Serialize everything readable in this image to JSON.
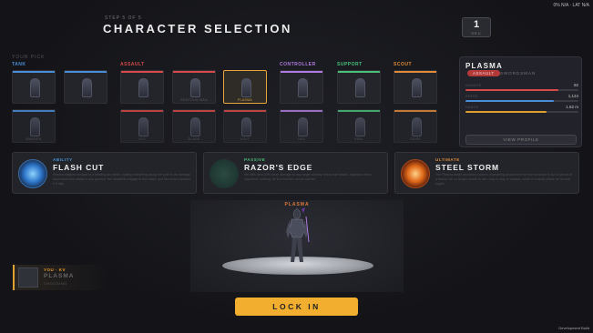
{
  "network": {
    "text": "0% N/A  ·  LAT N/A"
  },
  "header": {
    "step": "STEP 5 OF 5",
    "title": "CHARACTER SELECTION",
    "timer_value": "1",
    "timer_label": "SEC"
  },
  "picks_label": "YOUR PICK",
  "categories": [
    {
      "label": "TANK",
      "color": "#4a8ed8"
    },
    {
      "label": "ASSAULT",
      "color": "#d84a4a"
    },
    {
      "label": "CONTROLLER",
      "color": "#b07ae0"
    },
    {
      "label": "SUPPORT",
      "color": "#4ac07a"
    },
    {
      "label": "SCOUT",
      "color": "#e08a3a"
    }
  ],
  "tiles": [
    {
      "label": "",
      "color": "#4a8ed8"
    },
    {
      "label": "",
      "color": "#4a8ed8"
    },
    {
      "label": "JUGGERNAUT",
      "color": "#4a8ed8"
    },
    {
      "label": "",
      "color": "#d84a4a"
    },
    {
      "label": "SHOTGUN MAN",
      "color": "#d84a4a"
    },
    {
      "label": "PLASMA",
      "color": "#e8a53a"
    },
    {
      "label": "",
      "color": "#b07ae0"
    },
    {
      "label": "",
      "color": "#4ac07a"
    },
    {
      "label": "",
      "color": "#e08a3a"
    },
    {
      "label": "WARDEN",
      "color": "#4a8ed8"
    },
    {
      "label": "VEX",
      "color": "#d84a4a"
    },
    {
      "label": "BLADE",
      "color": "#d84a4a"
    },
    {
      "label": "VOLT",
      "color": "#d84a4a"
    },
    {
      "label": "HEX",
      "color": "#b07ae0"
    },
    {
      "label": "HEAL",
      "color": "#4ac07a"
    },
    {
      "label": "SNIPE",
      "color": "#e08a3a"
    }
  ],
  "profile": {
    "name": "PLASMA",
    "tag": "ASSAULT",
    "role": "SWORDSMAN",
    "stats": [
      {
        "name": "DAMAGE",
        "value": "92",
        "fraction": 0.82,
        "color": "#d84a4a"
      },
      {
        "name": "SPEED",
        "value": "1,124",
        "fraction": 0.78,
        "color": "#4a8ed8"
      },
      {
        "name": "RANGE",
        "value": "1.62 m",
        "fraction": 0.72,
        "color": "#e0a030"
      }
    ],
    "view_button": "VIEW PROFILE"
  },
  "abilities": [
    {
      "type": "ABILITY",
      "type_color": "#4a9ae0",
      "name": "FLASH CUT",
      "desc": "Plasma slashes forward in a blinding arc strike, cutting everything along the path to do damage. Movement and attack in one gesture: the deadliest engage in the roster, and the most exposed if it fails."
    },
    {
      "type": "PASSIVE",
      "type_color": "#4ac07a",
      "name": "RAZOR'S EDGE",
      "desc": "Her kills deal 10% more damage to any target already below half health. Against a fresh opponent, nothing; he is a finisher, not an opener."
    },
    {
      "type": "ULTIMATE",
      "type_color": "#e08a3a",
      "name": "STEEL STORM",
      "desc": "The Plasma blade becomes a storm: everything around him for four seconds is cut to pieces in a frenzy. He no longer needs to aim, only to stay in contact, which is exactly where he is most fragile."
    }
  ],
  "stage": {
    "hero_name": "PLASMA"
  },
  "lock_button": "LOCK IN",
  "you": {
    "tag": "YOU · KV",
    "hero": "PLASMA",
    "role": "CHOOSING"
  },
  "build": "Development Build"
}
